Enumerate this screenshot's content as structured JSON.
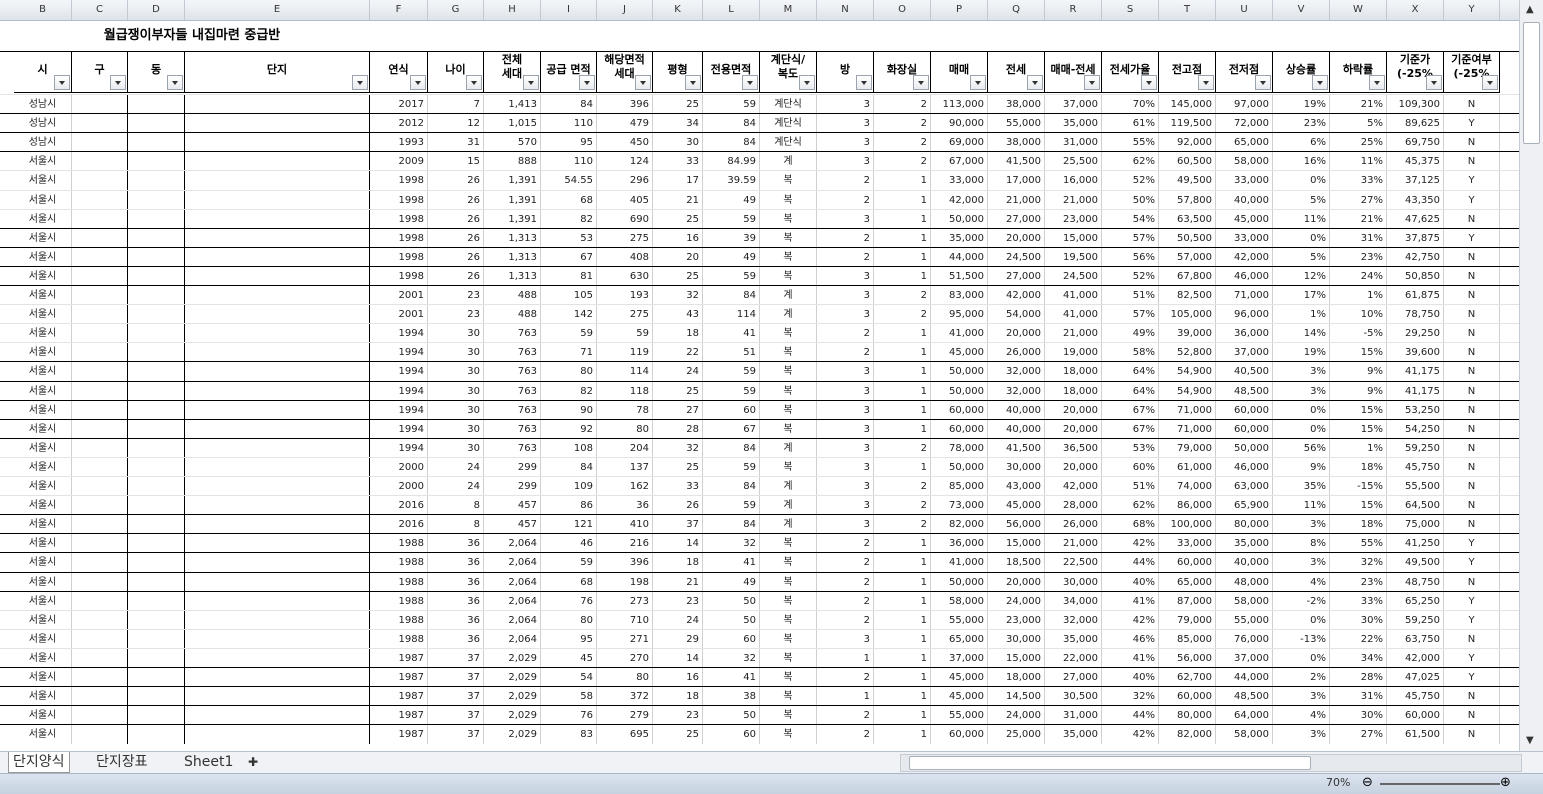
{
  "sheet_title": "월급쟁이부자들 내집마련 중급반",
  "columns": [
    "B",
    "C",
    "D",
    "E",
    "F",
    "G",
    "H",
    "I",
    "J",
    "K",
    "L",
    "M",
    "N",
    "O",
    "P",
    "Q",
    "R",
    "S",
    "T",
    "U",
    "V",
    "W",
    "X",
    "Y"
  ],
  "headers": [
    "시",
    "구",
    "동",
    "단지",
    "연식",
    "나이",
    "전체\n세대",
    "공급 면적",
    "해당면적\n세대",
    "평형",
    "전용면적",
    "계단식/\n복도",
    "방",
    "화장실",
    "매매",
    "전세",
    "매매-전세",
    "전세가율",
    "전고점",
    "전저점",
    "상승률",
    "하락률",
    "기준가\n(-25%",
    "기준여부\n(-25%"
  ],
  "rows": [
    [
      "성남시",
      "",
      "",
      "",
      "2017",
      "7",
      "1,413",
      "84",
      "396",
      "25",
      "59",
      "계단식",
      "3",
      "2",
      "113,000",
      "38,000",
      "37,000",
      "70%",
      "145,000",
      "97,000",
      "19%",
      "21%",
      "109,300",
      "N"
    ],
    [
      "성남시",
      "",
      "",
      "",
      "2012",
      "12",
      "1,015",
      "110",
      "479",
      "34",
      "84",
      "계단식",
      "3",
      "2",
      "90,000",
      "55,000",
      "35,000",
      "61%",
      "119,500",
      "72,000",
      "23%",
      "5%",
      "89,625",
      "Y"
    ],
    [
      "성남시",
      "",
      "",
      "",
      "1993",
      "31",
      "570",
      "95",
      "450",
      "30",
      "84",
      "계단식",
      "3",
      "2",
      "69,000",
      "38,000",
      "31,000",
      "55%",
      "92,000",
      "65,000",
      "6%",
      "25%",
      "69,750",
      "N"
    ],
    [
      "서울시",
      "",
      "",
      "",
      "2009",
      "15",
      "888",
      "110",
      "124",
      "33",
      "84.99",
      "계",
      "3",
      "2",
      "67,000",
      "41,500",
      "25,500",
      "62%",
      "60,500",
      "58,000",
      "16%",
      "11%",
      "45,375",
      "N"
    ],
    [
      "서울시",
      "",
      "",
      "",
      "1998",
      "26",
      "1,391",
      "54.55",
      "296",
      "17",
      "39.59",
      "복",
      "2",
      "1",
      "33,000",
      "17,000",
      "16,000",
      "52%",
      "49,500",
      "33,000",
      "0%",
      "33%",
      "37,125",
      "Y"
    ],
    [
      "서울시",
      "",
      "",
      "",
      "1998",
      "26",
      "1,391",
      "68",
      "405",
      "21",
      "49",
      "복",
      "2",
      "1",
      "42,000",
      "21,000",
      "21,000",
      "50%",
      "57,800",
      "40,000",
      "5%",
      "27%",
      "43,350",
      "Y"
    ],
    [
      "서울시",
      "",
      "",
      "",
      "1998",
      "26",
      "1,391",
      "82",
      "690",
      "25",
      "59",
      "복",
      "3",
      "1",
      "50,000",
      "27,000",
      "23,000",
      "54%",
      "63,500",
      "45,000",
      "11%",
      "21%",
      "47,625",
      "N"
    ],
    [
      "서울시",
      "",
      "",
      "",
      "1998",
      "26",
      "1,313",
      "53",
      "275",
      "16",
      "39",
      "복",
      "2",
      "1",
      "35,000",
      "20,000",
      "15,000",
      "57%",
      "50,500",
      "33,000",
      "0%",
      "31%",
      "37,875",
      "Y"
    ],
    [
      "서울시",
      "",
      "",
      "",
      "1998",
      "26",
      "1,313",
      "67",
      "408",
      "20",
      "49",
      "복",
      "2",
      "1",
      "44,000",
      "24,500",
      "19,500",
      "56%",
      "57,000",
      "42,000",
      "5%",
      "23%",
      "42,750",
      "N"
    ],
    [
      "서울시",
      "",
      "",
      "",
      "1998",
      "26",
      "1,313",
      "81",
      "630",
      "25",
      "59",
      "복",
      "3",
      "1",
      "51,500",
      "27,000",
      "24,500",
      "52%",
      "67,800",
      "46,000",
      "12%",
      "24%",
      "50,850",
      "N"
    ],
    [
      "서울시",
      "",
      "",
      "",
      "2001",
      "23",
      "488",
      "105",
      "193",
      "32",
      "84",
      "계",
      "3",
      "2",
      "83,000",
      "42,000",
      "41,000",
      "51%",
      "82,500",
      "71,000",
      "17%",
      "1%",
      "61,875",
      "N"
    ],
    [
      "서울시",
      "",
      "",
      "",
      "2001",
      "23",
      "488",
      "142",
      "275",
      "43",
      "114",
      "계",
      "3",
      "2",
      "95,000",
      "54,000",
      "41,000",
      "57%",
      "105,000",
      "96,000",
      "1%",
      "10%",
      "78,750",
      "N"
    ],
    [
      "서울시",
      "",
      "",
      "",
      "1994",
      "30",
      "763",
      "59",
      "59",
      "18",
      "41",
      "복",
      "2",
      "1",
      "41,000",
      "20,000",
      "21,000",
      "49%",
      "39,000",
      "36,000",
      "14%",
      "-5%",
      "29,250",
      "N"
    ],
    [
      "서울시",
      "",
      "",
      "",
      "1994",
      "30",
      "763",
      "71",
      "119",
      "22",
      "51",
      "복",
      "2",
      "1",
      "45,000",
      "26,000",
      "19,000",
      "58%",
      "52,800",
      "37,000",
      "19%",
      "15%",
      "39,600",
      "N"
    ],
    [
      "서울시",
      "",
      "",
      "",
      "1994",
      "30",
      "763",
      "80",
      "114",
      "24",
      "59",
      "복",
      "3",
      "1",
      "50,000",
      "32,000",
      "18,000",
      "64%",
      "54,900",
      "40,500",
      "3%",
      "9%",
      "41,175",
      "N"
    ],
    [
      "서울시",
      "",
      "",
      "",
      "1994",
      "30",
      "763",
      "82",
      "118",
      "25",
      "59",
      "복",
      "3",
      "1",
      "50,000",
      "32,000",
      "18,000",
      "64%",
      "54,900",
      "48,500",
      "3%",
      "9%",
      "41,175",
      "N"
    ],
    [
      "서울시",
      "",
      "",
      "",
      "1994",
      "30",
      "763",
      "90",
      "78",
      "27",
      "60",
      "복",
      "3",
      "1",
      "60,000",
      "40,000",
      "20,000",
      "67%",
      "71,000",
      "60,000",
      "0%",
      "15%",
      "53,250",
      "N"
    ],
    [
      "서울시",
      "",
      "",
      "",
      "1994",
      "30",
      "763",
      "92",
      "80",
      "28",
      "67",
      "복",
      "3",
      "1",
      "60,000",
      "40,000",
      "20,000",
      "67%",
      "71,000",
      "60,000",
      "0%",
      "15%",
      "54,250",
      "N"
    ],
    [
      "서울시",
      "",
      "",
      "",
      "1994",
      "30",
      "763",
      "108",
      "204",
      "32",
      "84",
      "계",
      "3",
      "2",
      "78,000",
      "41,500",
      "36,500",
      "53%",
      "79,000",
      "50,000",
      "56%",
      "1%",
      "59,250",
      "N"
    ],
    [
      "서울시",
      "",
      "",
      "",
      "2000",
      "24",
      "299",
      "84",
      "137",
      "25",
      "59",
      "복",
      "3",
      "1",
      "50,000",
      "30,000",
      "20,000",
      "60%",
      "61,000",
      "46,000",
      "9%",
      "18%",
      "45,750",
      "N"
    ],
    [
      "서울시",
      "",
      "",
      "",
      "2000",
      "24",
      "299",
      "109",
      "162",
      "33",
      "84",
      "계",
      "3",
      "2",
      "85,000",
      "43,000",
      "42,000",
      "51%",
      "74,000",
      "63,000",
      "35%",
      "-15%",
      "55,500",
      "N"
    ],
    [
      "서울시",
      "",
      "",
      "",
      "2016",
      "8",
      "457",
      "86",
      "36",
      "26",
      "59",
      "계",
      "3",
      "2",
      "73,000",
      "45,000",
      "28,000",
      "62%",
      "86,000",
      "65,900",
      "11%",
      "15%",
      "64,500",
      "N"
    ],
    [
      "서울시",
      "",
      "",
      "",
      "2016",
      "8",
      "457",
      "121",
      "410",
      "37",
      "84",
      "계",
      "3",
      "2",
      "82,000",
      "56,000",
      "26,000",
      "68%",
      "100,000",
      "80,000",
      "3%",
      "18%",
      "75,000",
      "N"
    ],
    [
      "서울시",
      "",
      "",
      "",
      "1988",
      "36",
      "2,064",
      "46",
      "216",
      "14",
      "32",
      "복",
      "2",
      "1",
      "36,000",
      "15,000",
      "21,000",
      "42%",
      "33,000",
      "35,000",
      "8%",
      "55%",
      "41,250",
      "Y"
    ],
    [
      "서울시",
      "",
      "",
      "",
      "1988",
      "36",
      "2,064",
      "59",
      "396",
      "18",
      "41",
      "복",
      "2",
      "1",
      "41,000",
      "18,500",
      "22,500",
      "44%",
      "60,000",
      "40,000",
      "3%",
      "32%",
      "49,500",
      "Y"
    ],
    [
      "서울시",
      "",
      "",
      "",
      "1988",
      "36",
      "2,064",
      "68",
      "198",
      "21",
      "49",
      "복",
      "2",
      "1",
      "50,000",
      "20,000",
      "30,000",
      "40%",
      "65,000",
      "48,000",
      "4%",
      "23%",
      "48,750",
      "N"
    ],
    [
      "서울시",
      "",
      "",
      "",
      "1988",
      "36",
      "2,064",
      "76",
      "273",
      "23",
      "50",
      "복",
      "2",
      "1",
      "58,000",
      "24,000",
      "34,000",
      "41%",
      "87,000",
      "58,000",
      "-2%",
      "33%",
      "65,250",
      "Y"
    ],
    [
      "서울시",
      "",
      "",
      "",
      "1988",
      "36",
      "2,064",
      "80",
      "710",
      "24",
      "50",
      "복",
      "2",
      "1",
      "55,000",
      "23,000",
      "32,000",
      "42%",
      "79,000",
      "55,000",
      "0%",
      "30%",
      "59,250",
      "Y"
    ],
    [
      "서울시",
      "",
      "",
      "",
      "1988",
      "36",
      "2,064",
      "95",
      "271",
      "29",
      "60",
      "복",
      "3",
      "1",
      "65,000",
      "30,000",
      "35,000",
      "46%",
      "85,000",
      "76,000",
      "-13%",
      "22%",
      "63,750",
      "N"
    ],
    [
      "서울시",
      "",
      "",
      "",
      "1987",
      "37",
      "2,029",
      "45",
      "270",
      "14",
      "32",
      "복",
      "1",
      "1",
      "37,000",
      "15,000",
      "22,000",
      "41%",
      "56,000",
      "37,000",
      "0%",
      "34%",
      "42,000",
      "Y"
    ],
    [
      "서울시",
      "",
      "",
      "",
      "1987",
      "37",
      "2,029",
      "54",
      "80",
      "16",
      "41",
      "복",
      "2",
      "1",
      "45,000",
      "18,000",
      "27,000",
      "40%",
      "62,700",
      "44,000",
      "2%",
      "28%",
      "47,025",
      "Y"
    ],
    [
      "서울시",
      "",
      "",
      "",
      "1987",
      "37",
      "2,029",
      "58",
      "372",
      "18",
      "38",
      "복",
      "1",
      "1",
      "45,000",
      "14,500",
      "30,500",
      "32%",
      "60,000",
      "48,500",
      "3%",
      "31%",
      "45,750",
      "N"
    ],
    [
      "서울시",
      "",
      "",
      "",
      "1987",
      "37",
      "2,029",
      "76",
      "279",
      "23",
      "50",
      "복",
      "2",
      "1",
      "55,000",
      "24,000",
      "31,000",
      "44%",
      "80,000",
      "64,000",
      "4%",
      "30%",
      "60,000",
      "N"
    ],
    [
      "서울시",
      "",
      "",
      "",
      "1987",
      "37",
      "2,029",
      "83",
      "695",
      "25",
      "60",
      "복",
      "2",
      "1",
      "60,000",
      "25,000",
      "35,000",
      "42%",
      "82,000",
      "58,000",
      "3%",
      "27%",
      "61,500",
      "N"
    ]
  ],
  "sheet_tabs": [
    "단지양식",
    "단지장표",
    "Sheet1"
  ],
  "zoom": "70%",
  "icons": {
    "filter": "filter-dropdown-icon",
    "new_sheet": "new-sheet-icon"
  },
  "colors": {
    "border": "#000000",
    "header_bg": "#dfe4ea"
  }
}
